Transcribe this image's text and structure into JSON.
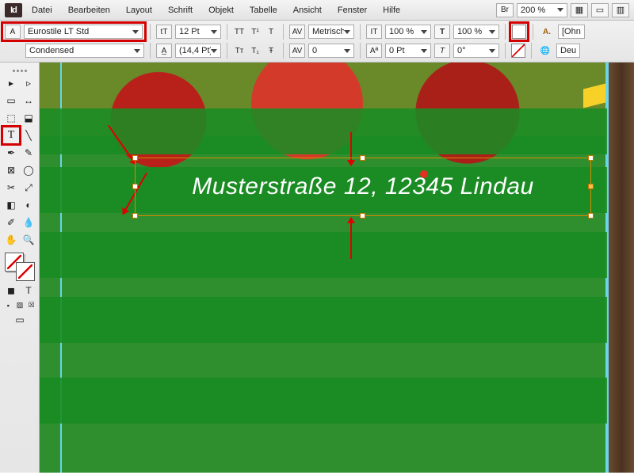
{
  "app": {
    "logo": "Id"
  },
  "menu": {
    "items": [
      "Datei",
      "Bearbeiten",
      "Layout",
      "Schrift",
      "Objekt",
      "Tabelle",
      "Ansicht",
      "Fenster",
      "Hilfe"
    ],
    "br_label": "Br",
    "zoom": "200 %"
  },
  "char": {
    "font_icon": "A",
    "font_family": "Eurostile LT Std",
    "font_style": "Condensed",
    "size_icon": "tT",
    "size": "12 Pt",
    "leading": "(14,4 Pt)",
    "caps_icons": [
      "TT",
      "T¹",
      "T"
    ],
    "caps_icons2": [
      "Tт",
      "T₁",
      "Ŧ"
    ],
    "kern_icon": "A͏V",
    "kern": "Metrisch",
    "kern2": "0",
    "hscale_icon": "IT",
    "hscale": "100 %",
    "vscale_icon": "T",
    "vscale": "100 %",
    "baseline_icon": "Aª",
    "baseline": "0 Pt",
    "skew_icon": "T",
    "skew": "0°",
    "fill_icon": "T",
    "fill_label": "A.",
    "lang": "Deut",
    "para": "[Ohn"
  },
  "canvas": {
    "text": "Musterstraße 12, 12345 Lindau"
  },
  "tools": {
    "names": [
      "selection",
      "direct-selection",
      "page",
      "gap",
      "content-collector",
      "content-placer",
      "type",
      "line",
      "pen",
      "pencil",
      "rectangle-frame",
      "ellipse-frame",
      "rectangle",
      "scissors",
      "free-transform",
      "gradient-swatch",
      "gradient-feather",
      "note",
      "eyedropper",
      "hand",
      "zoom"
    ]
  }
}
